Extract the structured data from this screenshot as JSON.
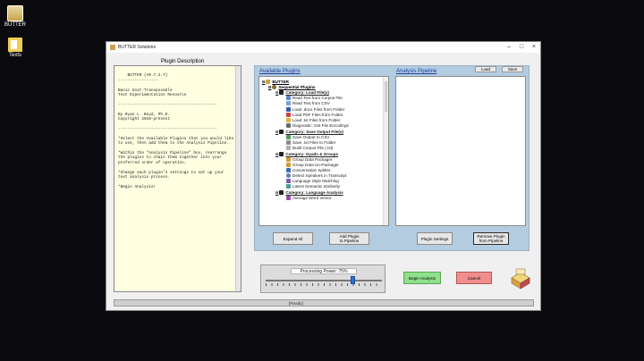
{
  "desktop": {
    "icons": [
      {
        "label": "BUTTER"
      },
      {
        "label": "Texts"
      }
    ]
  },
  "window": {
    "title": "BUTTER Solutions",
    "controls": {
      "minimize": "–",
      "maximize": "□",
      "close": "×"
    }
  },
  "plugin_description": {
    "title": "Plugin Description",
    "text": "BUTTER (v0.7.2.7)\n-----------------\n\nBasic Unit-Transposable\nText Experimentation Resource\n\n------------------------------------------\n\nBy Ryan L. Boyd, Ph.D.\nCopyright 2019-present\n\n------------------------------------------\n\n*Select the Available Plugins that you would like\nto use, then add them to the Analysis Pipeline.\n\n*Within the \"Analysis Pipeline\" box, rearrange\nthe plugins to chain them together into your\npreferred order of operation.\n\n*Change each plugin's settings to set up your\ntext analysis process.\n\n*Begin Analysis!"
  },
  "available_plugins": {
    "label": "Available Plugins",
    "root": "BUTTER",
    "sequential": "Sequential Plugins",
    "categories": [
      {
        "name": "Category: Load File(s)",
        "items": [
          "Read Text from Corpus File",
          "Read Text from CSV",
          "Load .docx Files from Folder",
          "Load PDF Files from Folder",
          "Load .txt Files from Folder",
          "Diagnostic: Get File Encodings"
        ]
      },
      {
        "name": "Category: Save Output File(s)",
        "items": [
          "Save Output to CSV",
          "Save .txt Files to Folder",
          "Build Corpus File (.txt)"
        ]
      },
      {
        "name": "Category: Dyads & Groups",
        "items": [
          "Group Data Packager",
          "Group Data Un-Packager",
          "Conversation Splitter",
          "Detect Speakers in Transcript",
          "Language Style Matching",
          "Latent Semantic Similarity"
        ]
      },
      {
        "name": "Category: Language Analysis",
        "items": [
          "Average Word Vector"
        ]
      }
    ]
  },
  "analysis_pipeline": {
    "label": "Analysis Pipeline",
    "load_label": "Load",
    "save_label": "Save"
  },
  "buttons": {
    "expand_all": "Expand All",
    "add_plugin": "Add Plugin\nto Pipeline",
    "plugin_settings": "Plugin Settings",
    "remove_plugin": "Remove Plugin\nfrom Pipeline",
    "begin": "Begin Analysis",
    "cancel": "Cancel"
  },
  "processing": {
    "label": "Processing Power:  75%",
    "value_percent": 75
  },
  "status": {
    "text": "[Ready]"
  },
  "colors": {
    "panel_blue": "#b4cce0",
    "description_bg": "#ffffe1",
    "begin_green": "#8fe08a",
    "cancel_red": "#f08e8e",
    "link_blue": "#1a3fa3"
  }
}
